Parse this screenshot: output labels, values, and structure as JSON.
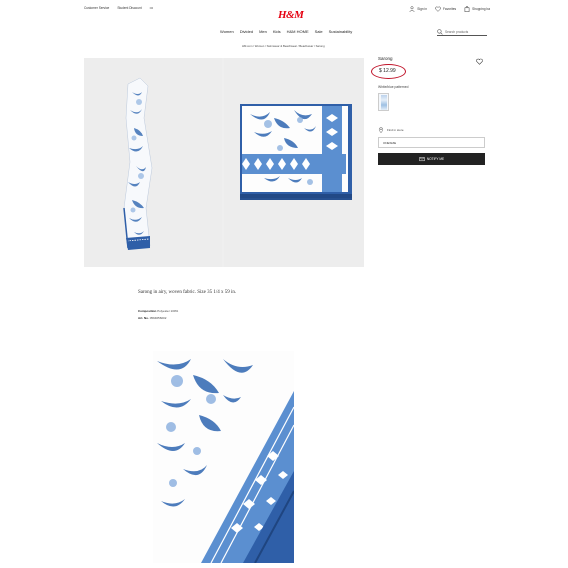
{
  "topbar": {
    "customer_service": "Customer Service",
    "student_discount": "Student Discount",
    "more": "•••",
    "sign_in": "Sign in",
    "favorites": "Favorites",
    "shopping_bag": "Shopping ba"
  },
  "logo": {
    "text": "H&M",
    "color": "#e50010"
  },
  "nav": [
    "Women",
    "Divided",
    "Men",
    "Kids",
    "H&M HOME",
    "Sale",
    "Sustainability"
  ],
  "search": {
    "placeholder": "Search products"
  },
  "breadcrumb": "HM.com / Women / Swimwear & Beachwear / Beachwear / Sarong",
  "product": {
    "title": "Sarong",
    "price": "$ 12.99",
    "color": "White/blue patterned",
    "find_store": "Find in store",
    "size": "ONESIZE",
    "notify_button": "NOTIFY ME",
    "description": "Sarong in airy, woven fabric. Size 35 1/4 x 59 in.",
    "composition_label": "Composition",
    "composition_value": "Polyester 100%",
    "art_no_label": "Art. No.",
    "art_no_value": "0594656002"
  },
  "icons": {
    "person": "person-icon",
    "heart": "heart-icon",
    "bag": "bag-icon",
    "search": "search-icon",
    "pin": "location-pin-icon",
    "envelope": "envelope-icon"
  },
  "colors": {
    "accent": "#e50010",
    "annotation_circle": "#c0142a",
    "pattern_blue": "#2f5fa8"
  }
}
